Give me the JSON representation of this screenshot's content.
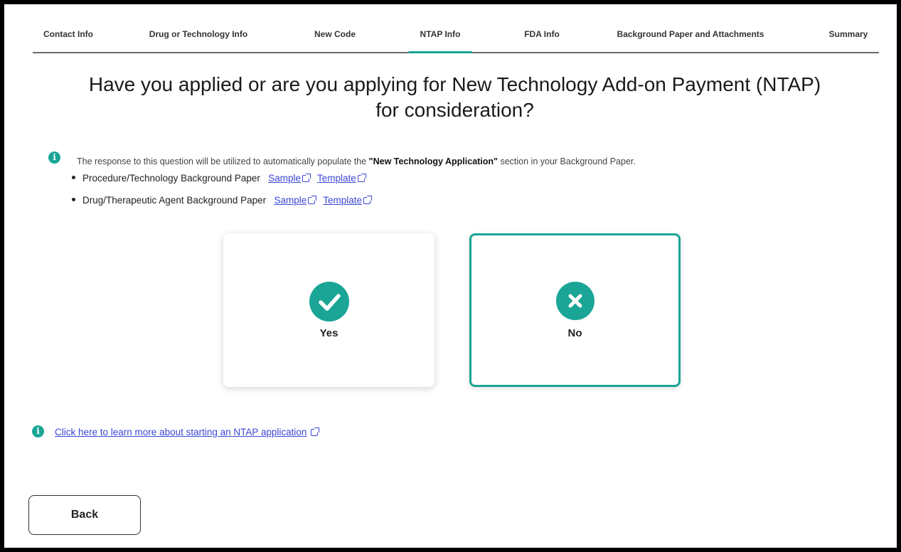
{
  "tabs": [
    {
      "label": "Contact Info"
    },
    {
      "label": "Drug or Technology Info"
    },
    {
      "label": "New Code"
    },
    {
      "label": "NTAP Info",
      "active": true
    },
    {
      "label": "FDA Info"
    },
    {
      "label": "Background Paper and Attachments"
    },
    {
      "label": "Summary"
    }
  ],
  "title_line1": "Have you applied or are you applying for New Technology Add-on Payment (NTAP)",
  "title_line2": "for consideration?",
  "info": {
    "text_before": "The response to this question will be utilized to automatically populate the ",
    "bold": "\"New Technology Application\"",
    "text_after": " section in your Background Paper.",
    "icon": "info-icon"
  },
  "bullets": [
    {
      "label": "Procedure/Technology Background Paper",
      "sample": "Sample",
      "template": "Template"
    },
    {
      "label": "Drug/Therapeutic Agent Background Paper",
      "sample": "Sample",
      "template": "Template"
    }
  ],
  "options": {
    "yes": {
      "label": "Yes",
      "icon": "check-icon"
    },
    "no": {
      "label": "No",
      "icon": "close-icon",
      "selected": true
    }
  },
  "learn_more": "Click here to learn more about starting an NTAP application",
  "back_label": "Back",
  "colors": {
    "accent": "#1aa596",
    "link": "#3b48d6"
  }
}
